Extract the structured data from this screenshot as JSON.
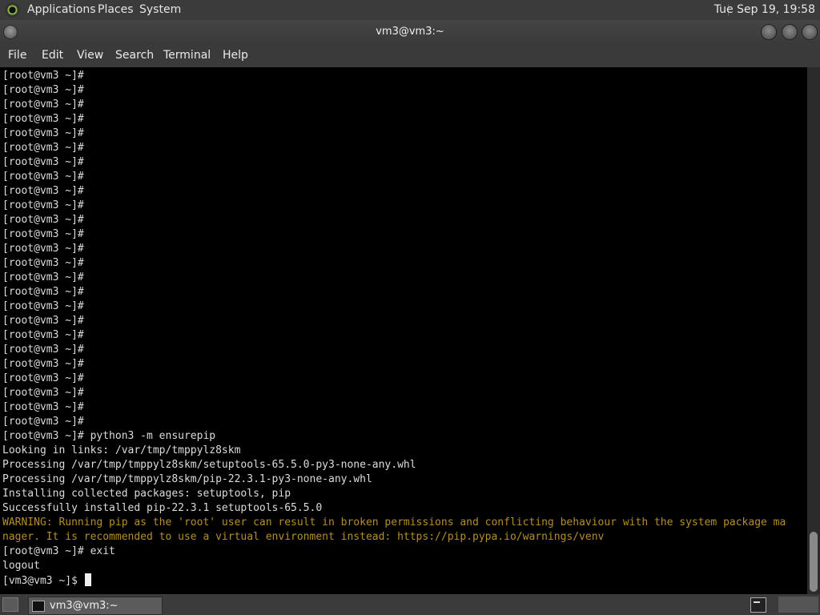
{
  "top_panel": {
    "applications_label": "Applications",
    "places_label": "Places",
    "system_label": "System",
    "clock": "Tue Sep 19, 19:58"
  },
  "window": {
    "title": "vm3@vm3:~"
  },
  "menubar": {
    "file": "File",
    "edit": "Edit",
    "view": "View",
    "search": "Search",
    "terminal": "Terminal",
    "help": "Help"
  },
  "terminal": {
    "lines": [
      "[root@vm3 ~]#",
      "[root@vm3 ~]#",
      "[root@vm3 ~]#",
      "[root@vm3 ~]#",
      "[root@vm3 ~]#",
      "[root@vm3 ~]#",
      "[root@vm3 ~]#",
      "[root@vm3 ~]#",
      "[root@vm3 ~]#",
      "[root@vm3 ~]#",
      "[root@vm3 ~]#",
      "[root@vm3 ~]#",
      "[root@vm3 ~]#",
      "[root@vm3 ~]#",
      "[root@vm3 ~]#",
      "[root@vm3 ~]#",
      "[root@vm3 ~]#",
      "[root@vm3 ~]#",
      "[root@vm3 ~]#",
      "[root@vm3 ~]#",
      "[root@vm3 ~]#",
      "[root@vm3 ~]#",
      "[root@vm3 ~]#",
      "[root@vm3 ~]#",
      "[root@vm3 ~]#",
      "[root@vm3 ~]# python3 -m ensurepip",
      "Looking in links: /var/tmp/tmppylz8skm",
      "Processing /var/tmp/tmppylz8skm/setuptools-65.5.0-py3-none-any.whl",
      "Processing /var/tmp/tmppylz8skm/pip-22.3.1-py3-none-any.whl",
      "Installing collected packages: setuptools, pip",
      "Successfully installed pip-22.3.1 setuptools-65.5.0",
      "WARNING: Running pip as the 'root' user can result in broken permissions and conflicting behaviour with the system package ma",
      "nager. It is recommended to use a virtual environment instead: https://pip.pypa.io/warnings/venv",
      "[root@vm3 ~]# exit",
      "logout"
    ],
    "warning_line_indices": [
      31,
      32
    ],
    "current_prompt": "[vm3@vm3 ~]$ ",
    "warning_color": "#b58d2b"
  },
  "taskbar": {
    "task_label": "vm3@vm3:~"
  },
  "icons": {
    "app_logo": "distro-logo-icon",
    "window_icon": "terminal-window-icon",
    "show_desktop": "show-desktop-icon",
    "task_icon": "terminal-icon",
    "tray": "terminal-tray-icon"
  }
}
